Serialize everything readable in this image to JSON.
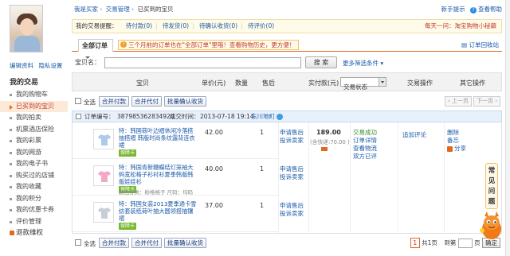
{
  "sidebar": {
    "links": [
      "编辑资料",
      "隐私设置"
    ],
    "section_title": "我的交易",
    "items": [
      {
        "label": "我的购物车",
        "type": "mini"
      },
      {
        "label": "已买到的宝贝",
        "type": "active"
      },
      {
        "label": "我的拍卖",
        "type": "mini"
      },
      {
        "label": "机票酒店保险",
        "type": "mini"
      },
      {
        "label": "我的彩票",
        "type": "mini"
      },
      {
        "label": "我的网游",
        "type": "mini"
      },
      {
        "label": "我的电子书",
        "type": "mini"
      },
      {
        "label": "购买过的店铺",
        "type": "mini"
      },
      {
        "label": "我的收藏",
        "type": "mini"
      },
      {
        "label": "我的积分",
        "type": "mini"
      },
      {
        "label": "我的优惠卡券",
        "type": "mini"
      },
      {
        "label": "评价管理",
        "type": "mini"
      },
      {
        "label": "退款维权",
        "type": "plain"
      }
    ]
  },
  "breadcrumb": {
    "home": "我是买家",
    "sep1": "›",
    "mid": "交易管理",
    "sep2": "›",
    "current": "已买到的宝贝"
  },
  "topright": {
    "tip": "新手提示",
    "help": "查看帮助"
  },
  "reminder": {
    "label": "我的交易提醒：",
    "items": [
      "待付款(0)",
      "待发货(0)",
      "待确认收货(0)",
      "待评价(0)"
    ],
    "promo": "每天一问：淘宝购物小秘籍"
  },
  "orderbar": {
    "tab": "全部订单",
    "warning": "三个月前的订单也在\"全部订单\"里哦！查看购物历史，更方便！",
    "recycle": "订单回收站"
  },
  "search": {
    "label": "宝贝名：",
    "placeholder": "",
    "button": "搜 索",
    "more": "更多筛选条件"
  },
  "columns": {
    "item": "宝贝",
    "price": "单价(元)",
    "qty": "数量",
    "aftersale": "售后",
    "paid": "实付款(元)",
    "status": "交易状态",
    "ops": "交易操作",
    "other": "其它操作"
  },
  "actions": {
    "select_all": "全选",
    "merge_pay": "合并付款",
    "merge_proxy": "合并代付",
    "batch_confirm": "批量确认收货",
    "prev": "上一页",
    "next": "下一页"
  },
  "order": {
    "checkbox_label": "订单编号：",
    "order_no": "387985362834920",
    "time_label": "成交时间：",
    "time": "2013-07-18 19:14",
    "shop": "东川地町",
    "paid_total": "189.00",
    "shipping_note": "(含快递:70.00 )",
    "status": [
      "交易成功",
      "订单详情",
      "查看物流",
      "双方已评"
    ],
    "deal_op": "追加评论",
    "other_ops": [
      "删除",
      "备忘",
      "分享"
    ],
    "products": [
      {
        "title": "特：韩国荷叶边褶休闲冷落搭抽搭褶 韩版时尚条纹露背连衣裙",
        "badge": "保障卡",
        "variant": "",
        "price": "42.00",
        "qty": "1",
        "aftersale": [
          "申请售后",
          "投诉卖家"
        ],
        "color": "#aec9ea"
      },
      {
        "title": "特：韩国青新糖蝶结灯笼袖大码宽松格子衫衬衫夏季韩版韩版娃娃衫",
        "badge": "保障卡",
        "variant": "颜色分类：粉格格子 尺码：均码",
        "price": "40.00",
        "qty": "1",
        "aftersale": [
          "申请售后",
          "投诉卖家"
        ],
        "color": "#f2a9c8"
      },
      {
        "title": "特：韩国女装2013夏季通卡雪纺套装纸荷叶抽大圆领搭抽镶褶",
        "badge": "保障卡",
        "variant": "",
        "price": "37.00",
        "qty": "1",
        "aftersale": [
          "申请售后",
          "投诉卖家"
        ],
        "color": "#c9cdd6"
      }
    ]
  },
  "pager": {
    "current": "1",
    "total": "共1页",
    "goto": "到第",
    "unit": "页",
    "confirm": "确定"
  },
  "faq": [
    "常",
    "见",
    "问",
    "题"
  ]
}
